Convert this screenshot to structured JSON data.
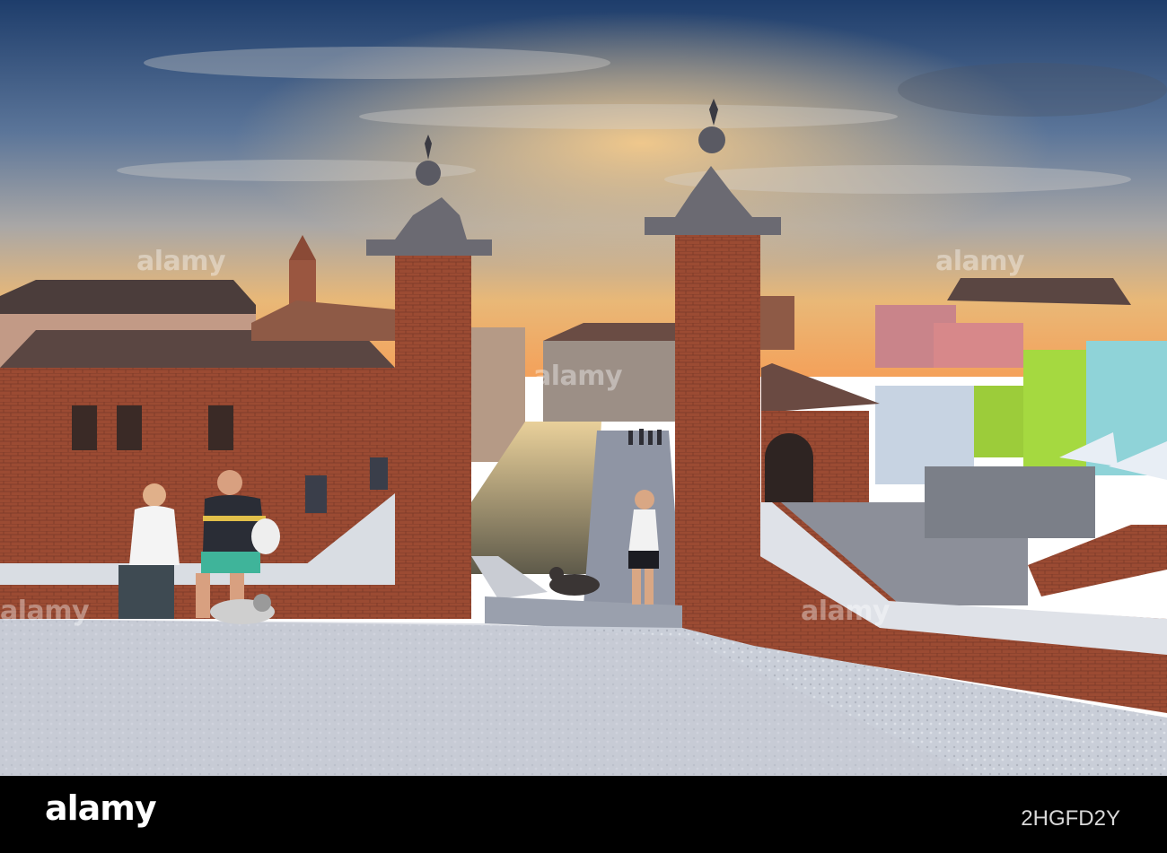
{
  "photo": {
    "colors": {
      "sky_top": "#2a4a78",
      "sky_mid": "#6f86a6",
      "sunset": "#f3b868",
      "brick": "#9a4a32",
      "canal_water": "#7a6a4e",
      "pavement": "#cfd4dc"
    }
  },
  "watermark": {
    "text": "alamy"
  },
  "footer": {
    "brand": "alamy",
    "image_id": "2HGFD2Y"
  }
}
